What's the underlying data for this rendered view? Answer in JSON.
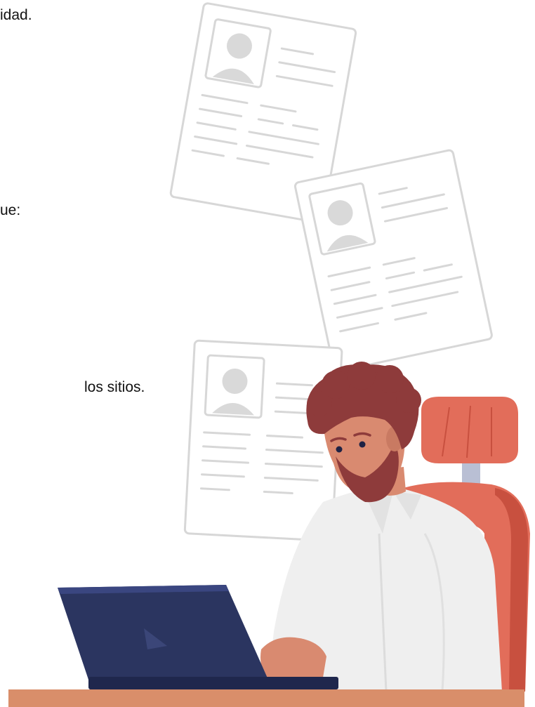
{
  "text": {
    "line1": "idad.",
    "line2": "ue:",
    "line3": "los sitios."
  },
  "colors": {
    "paper_stroke": "#d7d7d7",
    "avatar": "#d9d9d9",
    "laptop": "#2b3560",
    "desk": "#d98e6a",
    "chair": "#e26d5a",
    "shirt": "#efefef",
    "hair": "#8e3b3b",
    "skin": "#d98a70"
  },
  "icons": [
    "resume-document",
    "person-silhouette",
    "laptop",
    "office-chair"
  ]
}
